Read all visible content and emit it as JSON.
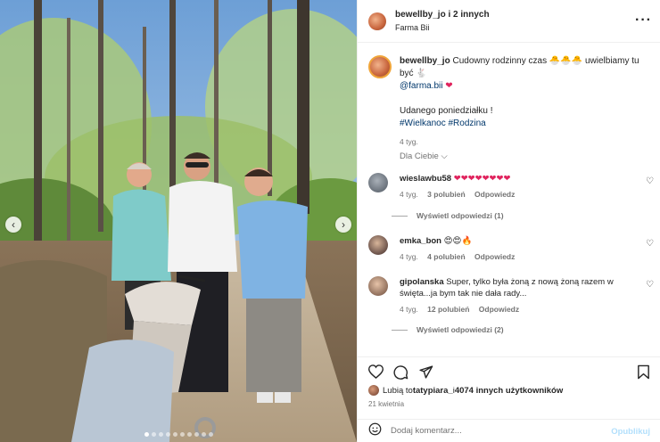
{
  "header": {
    "username": "bewellby_jo",
    "and_others": " i 2 innych",
    "location": "Farma Bii"
  },
  "caption": {
    "username": "bewellby_jo",
    "text": "Cudowny rodzinny czas 🐣🐣🐣 uwielbiamy tu być 🐇",
    "mention": "@farma.bii",
    "heart": "❤",
    "line2": "Udanego poniedziałku !",
    "hashtags": "#Wielkanoc #Rodzina",
    "time": "4 tyg."
  },
  "for_you": "Dla Ciebie ⌵",
  "comments": [
    {
      "username": "wieslawbu58",
      "text": "❤❤❤❤❤❤❤❤",
      "time": "4 tyg.",
      "likes": "3 polubień",
      "reply": "Odpowiedz",
      "replies": "Wyświetl odpowiedzi (1)"
    },
    {
      "username": "emka_bon",
      "text": "😍😍🔥",
      "time": "4 tyg.",
      "likes": "4 polubień",
      "reply": "Odpowiedz"
    },
    {
      "username": "gipolanska",
      "text": "Super, tylko była żoną z nową żoną razem w święta...ja bym tak nie dała rady...",
      "time": "4 tyg.",
      "likes": "12 polubień",
      "reply": "Odpowiedz",
      "replies": "Wyświetl odpowiedzi (2)"
    }
  ],
  "likes_row": {
    "prefix": "Lubią to ",
    "user": "tatypiara_",
    "middle": " i ",
    "count": "4074 innych użytkowników"
  },
  "date": "21 kwietnia",
  "composer": {
    "placeholder": "Dodaj komentarz...",
    "publish": "Opublikuj"
  },
  "icons": {
    "more": "more-options-icon",
    "like": "heart-icon",
    "comment": "comment-icon",
    "share": "share-icon",
    "save": "bookmark-icon",
    "emoji": "emoji-icon"
  },
  "carousel": {
    "total": 10,
    "active": 0
  },
  "colors": {
    "link": "#00376b",
    "heart": "#e0245e",
    "publish_disabled": "#b2dffc",
    "muted": "#737373"
  }
}
